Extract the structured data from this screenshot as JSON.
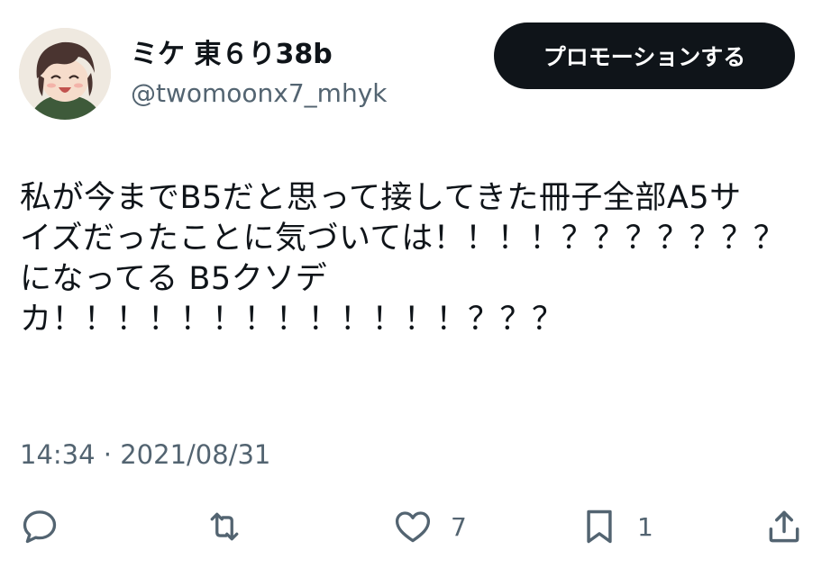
{
  "author": {
    "display_name": "ミケ 東６り38b",
    "handle": "@twomoonx7_mhyk"
  },
  "promote_button": {
    "label": "プロモーションする"
  },
  "tweet": {
    "lines": [
      "私が今までB5だと思って接してきた冊子全部A5サ",
      "イズだったことに気づいては！！！！？？？？？？？",
      "になってる B5クソデ",
      "カ！！！！！！！！！！！！！？？？"
    ],
    "timestamp": "14:34 · 2021/08/31"
  },
  "actions": {
    "reply": {
      "icon": "reply-icon",
      "count": ""
    },
    "retweet": {
      "icon": "retweet-icon",
      "count": ""
    },
    "like": {
      "icon": "heart-icon",
      "count": "7"
    },
    "bookmark": {
      "icon": "bookmark-icon",
      "count": "1"
    },
    "share": {
      "icon": "share-icon",
      "count": ""
    }
  },
  "colors": {
    "text_primary": "#0f1419",
    "text_secondary": "#536471",
    "button_bg": "#0f1419",
    "button_text": "#ffffff"
  }
}
